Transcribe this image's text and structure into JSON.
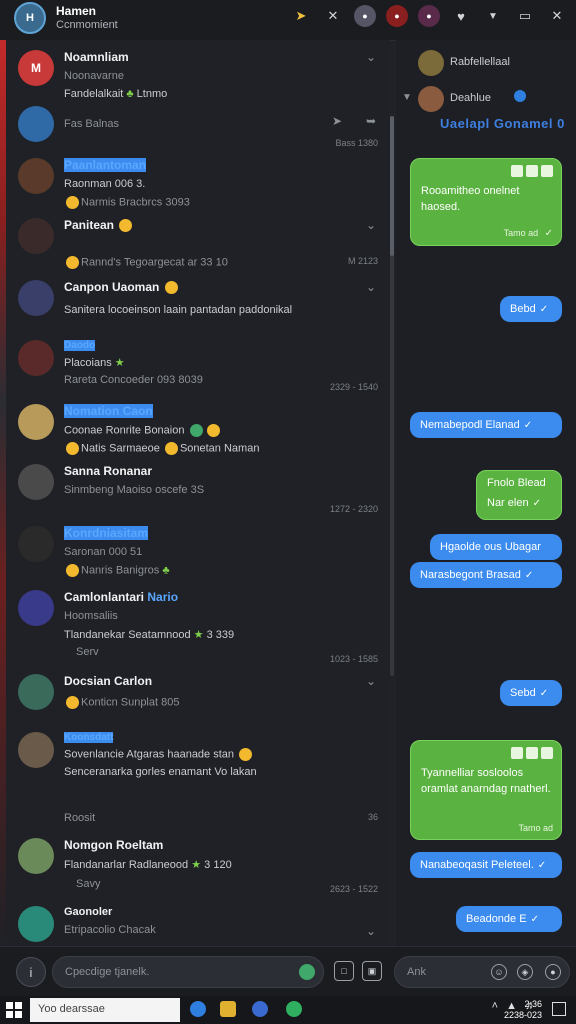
{
  "titlebar": {
    "name": "Hamen",
    "status": "Ccnmomient",
    "icons": [
      "pin-icon",
      "close-icon",
      "avatar",
      "avatar",
      "avatar",
      "ghost-icon",
      "chevron-down-icon",
      "window-icon",
      "close-icon"
    ]
  },
  "conversations": [
    {
      "name": "Noamnliam",
      "line1": "Noonavarne",
      "line2": "Fandelalkait",
      "line2b": "Ltnmo",
      "avatar_letter": "M",
      "avatar_color": "#c83a3a",
      "time": ""
    },
    {
      "name": "Fas Balnas",
      "line1": "",
      "line2": "",
      "avatar_letter": "",
      "avatar_color": "#2f6aa6",
      "time": "Bass 1380"
    },
    {
      "name": "Paanlantoman",
      "line1": "Raonman 006 3.",
      "line2": "Narmis Bracbrcs 3093",
      "avatar_letter": "",
      "avatar_color": "#5a3a2a",
      "time": ""
    },
    {
      "name": "Panitean",
      "line1": "Rannd's Tegoargecat ar 33 10",
      "line2": "",
      "avatar_letter": "",
      "avatar_color": "#3a2a2a",
      "time": "M 2123"
    },
    {
      "name": "Canpon Uaoman",
      "line1": "Sanitera locoeinson laain pantadan paddonikal",
      "line2": "",
      "avatar_letter": "",
      "avatar_color": "#3a3f6a",
      "time": ""
    },
    {
      "name": "Daodo",
      "line1": "Placoians",
      "line2": "Rareta Concoeder 093 8039",
      "avatar_letter": "",
      "avatar_color": "#5a2a2a",
      "time": "2329 - 1540"
    },
    {
      "name": "Nomation Caon",
      "line1": "Coonae Ronrite Bonaion",
      "line2": "Natis Sarmaeoe",
      "line2b": "Sonetan Naman",
      "avatar_letter": "",
      "avatar_color": "#b89a5a",
      "time": ""
    },
    {
      "name": "Sanna Ronanar",
      "line1": "Sinmbeng Maoiso oscefe 3S",
      "line2": "",
      "avatar_letter": "",
      "avatar_color": "#4a4a4a",
      "time": "1272 - 2320"
    },
    {
      "name": "Konrdniasitam",
      "line1": "Saronan 000 51",
      "line2": "Nanris Banigros",
      "avatar_letter": "",
      "avatar_color": "#2a2a2a",
      "time": ""
    },
    {
      "name": "Camlonlantari",
      "name_suffix": "Nario",
      "line1": "Hoomsaliis",
      "line2": "Tlandanekar Seatamnood",
      "line2b": "3 339",
      "line3": "Serv",
      "avatar_letter": "",
      "avatar_color": "#3a3a8a",
      "time": "1023 - 1585"
    },
    {
      "name": "Docsian Carlon",
      "line1": "Konticn Sunplat 805",
      "line2": "",
      "avatar_letter": "",
      "avatar_color": "#3a6a5a",
      "time": ""
    },
    {
      "name": "Koonsdatt",
      "line1": "Sovenlancie Atgaras haanade stan",
      "line2": "Senceranarka gorles enamant Vo lakan",
      "line3": "Roosit",
      "avatar_letter": "",
      "avatar_color": "#6a5a4a",
      "time": "36"
    },
    {
      "name": "Nomgon Roeltam",
      "line1": "Flandanarlar Radlaneood",
      "line2": "3 120",
      "line3": "Savy",
      "avatar_letter": "",
      "avatar_color": "#6a8a5a",
      "time": "2623 - 1522"
    },
    {
      "name": "Gaonoler",
      "line1": "Etripacolio Chacak",
      "line2": "",
      "avatar_letter": "",
      "avatar_color": "#2a8a7a",
      "time": ""
    }
  ],
  "chat": {
    "header_name": "Rabfellellaal",
    "sub_name": "Deahlue",
    "banner": "Uaelapl Gonamel 0",
    "messages": [
      {
        "kind": "green",
        "text": "Rooamitheo onelnet haosed.",
        "meta": "Tamo ad"
      },
      {
        "kind": "blue",
        "text": "Bebd"
      },
      {
        "kind": "blue",
        "text": "Nemabepodl Elanad"
      },
      {
        "kind": "green",
        "text": "Fnolo Blead",
        "text2": "Nar elen"
      },
      {
        "kind": "blue",
        "text": "Hgaolde ous Ubagar"
      },
      {
        "kind": "blue",
        "text": "Narasbegont Brasad"
      },
      {
        "kind": "blue",
        "text": "Sebd"
      },
      {
        "kind": "green",
        "text": "Tyannelliar sosloolos oramlat anarndag rnatherl.",
        "meta": "Tamo ad"
      },
      {
        "kind": "blue",
        "text": "Nanabeoqasit Peleteel."
      },
      {
        "kind": "blue",
        "text": "Beadonde E"
      }
    ]
  },
  "input": {
    "placeholder_left": "Cpecdige tjanelk.",
    "placeholder_right": "Ank"
  },
  "taskbar": {
    "search_placeholder": "Yoo dearssae",
    "clock_time": "2:36",
    "clock_date": "2238-023"
  }
}
